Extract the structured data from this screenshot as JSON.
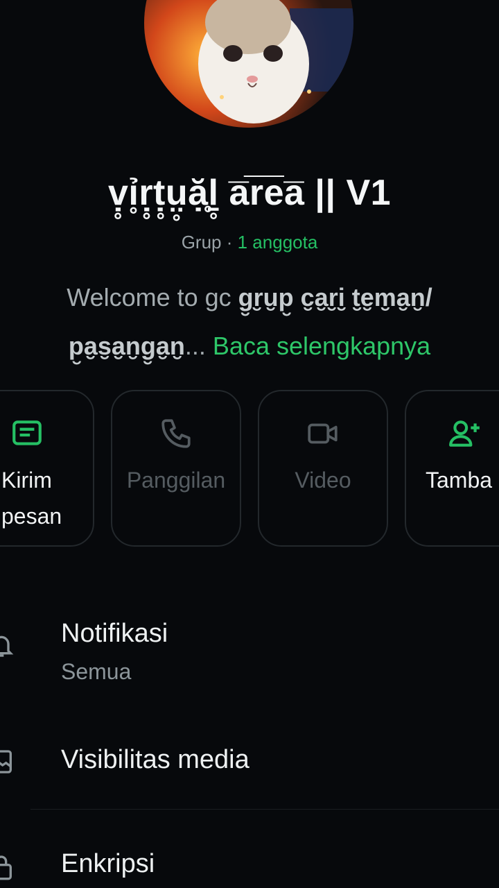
{
  "group": {
    "name": "ṿ̥ỉ̥ṛ̥ṭ̥ṳ̥ặ̥ḻ̥ a̅r̅e̅a̅ || V1",
    "type_label": "Grup",
    "separator": " · ",
    "members": "1 anggota",
    "description_prefix": "Welcome to gc ",
    "description_bold": "g̮r̮u̮p̮ c̮a̮r̮i̮ t̮e̮m̮a̮n̮/ p̮a̮s̮a̮n̮g̮a̮n̮",
    "description_ellipsis": "...",
    "read_more": "Baca selengkapnya"
  },
  "actions": [
    {
      "label": "Kirim pesan",
      "icon": "message-icon",
      "enabled": true
    },
    {
      "label": "Panggilan",
      "icon": "phone-icon",
      "enabled": false
    },
    {
      "label": "Video",
      "icon": "video-icon",
      "enabled": false
    },
    {
      "label": "Tamba",
      "icon": "add-person-icon",
      "enabled": true
    }
  ],
  "menu": [
    {
      "title": "Notifikasi",
      "subtitle": "Semua",
      "icon": "bell-icon"
    },
    {
      "title": "Visibilitas media",
      "icon": "media-icon"
    },
    {
      "title": "Enkripsi",
      "icon": "lock-icon"
    }
  ],
  "colors": {
    "background": "#07090c",
    "accent": "#25c064",
    "text": "#e9edef",
    "muted": "#9aa3a8"
  }
}
